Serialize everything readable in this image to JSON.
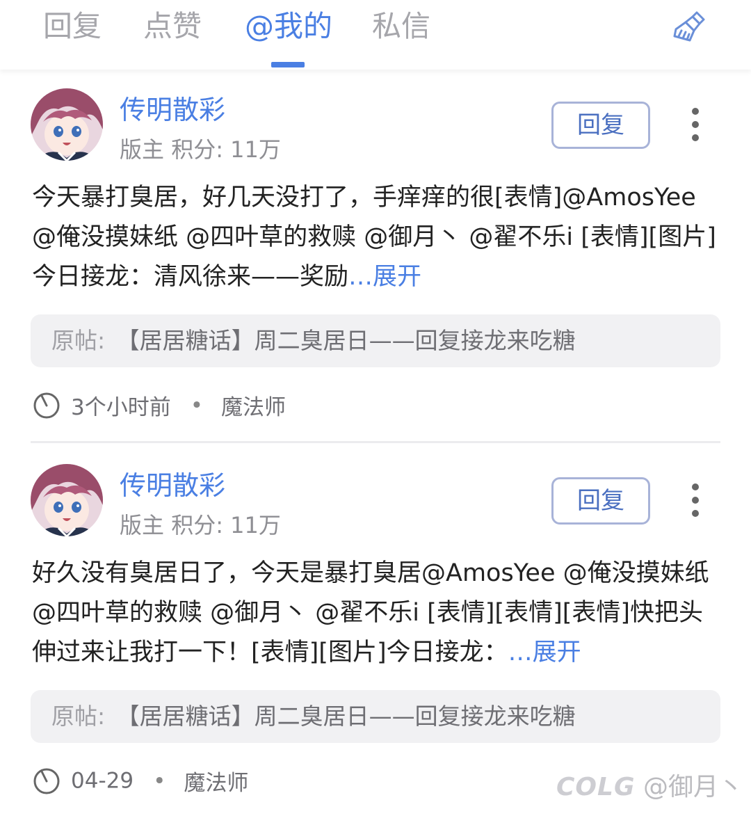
{
  "tabs": [
    "回复",
    "点赞",
    "@我的",
    "私信"
  ],
  "active_tab": 2,
  "posts": [
    {
      "username": "传明散彩",
      "role": "版主",
      "points": "积分: 11万",
      "reply_label": "回复",
      "text": "今天暴打臭居，好几天没打了，手痒痒的很[表情]@AmosYee @俺没摸妹纸 @四叶草的救赎 @御月丶 @翟不乐i [表情][图片]今日接龙：清风徐来——奖励",
      "expand": "…展开",
      "orig_label": "原帖:",
      "orig_title": "【居居糖话】周二臭居日——回复接龙来吃糖",
      "time": "3个小时前",
      "board": "魔法师"
    },
    {
      "username": "传明散彩",
      "role": "版主",
      "points": "积分: 11万",
      "reply_label": "回复",
      "text": "好久没有臭居日了，今天是暴打臭居@AmosYee @俺没摸妹纸 @四叶草的救赎 @御月丶 @翟不乐i [表情][表情][表情]快把头伸过来让我打一下！[表情][图片]今日接龙：",
      "expand": "…展开",
      "orig_label": "原帖:",
      "orig_title": "【居居糖话】周二臭居日——回复接龙来吃糖",
      "time": "04-29",
      "board": "魔法师"
    }
  ],
  "watermark": {
    "logo": "COLG",
    "handle": "@御月丶"
  },
  "colors": {
    "accent": "#4a7fe3",
    "tab_inactive": "#a6a6ab",
    "meta": "#8e8e93",
    "orig_bg": "#f1f1f3"
  }
}
